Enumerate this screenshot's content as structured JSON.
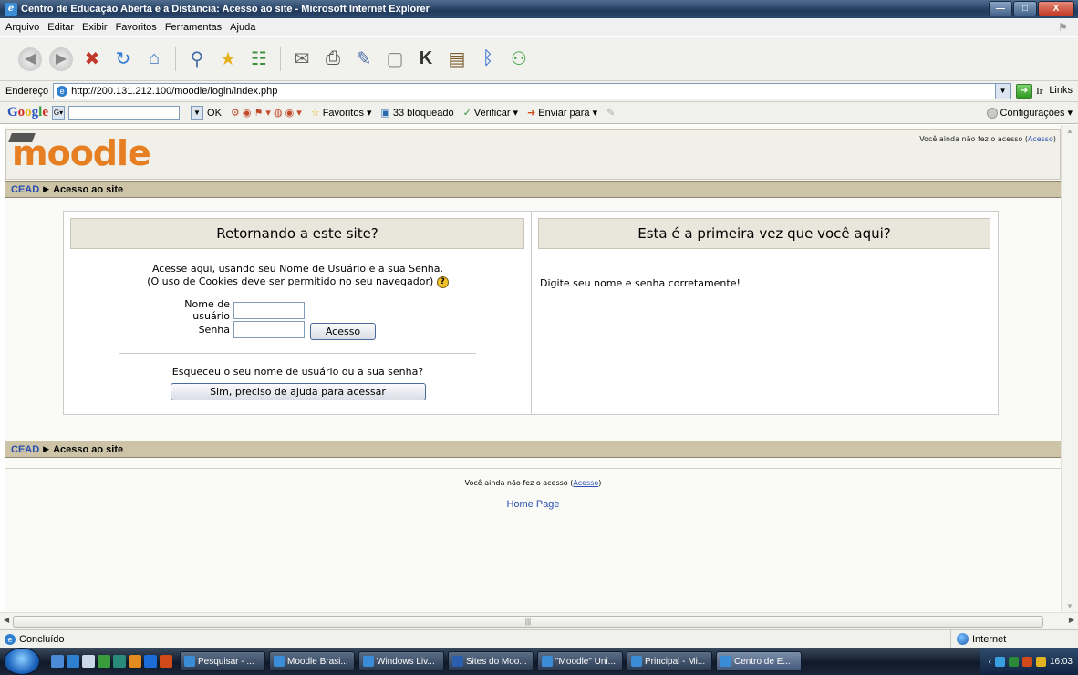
{
  "window": {
    "title": "Centro de Educação Aberta e a Distância: Acesso ao site - Microsoft Internet Explorer",
    "buttons": {
      "minimize": "—",
      "maximize": "□",
      "close": "X"
    }
  },
  "menubar": {
    "items": [
      "Arquivo",
      "Editar",
      "Exibir",
      "Favoritos",
      "Ferramentas",
      "Ajuda"
    ]
  },
  "addressbar": {
    "label": "Endereço",
    "url": "http://200.131.212.100/moodle/login/index.php",
    "go_label": "Ir",
    "links_label": "Links"
  },
  "googlebar": {
    "logo": "Google",
    "ok": "OK",
    "favoritos": "Favoritos",
    "blocked": "33 bloqueado",
    "verificar": "Verificar",
    "enviar": "Enviar para",
    "config": "Configurações"
  },
  "page": {
    "logo": "moodle",
    "login_info_text": "Você ainda não fez o acesso (",
    "login_info_link": "Acesso",
    "login_info_close": ")",
    "breadcrumb": {
      "home": "CEAD",
      "current": "Acesso ao site"
    },
    "left": {
      "heading": "Retornando a este site?",
      "intro_line1": "Acesse aqui, usando seu Nome de Usuário e a sua Senha.",
      "intro_line2": "(O uso de Cookies deve ser permitido no seu navegador)",
      "username_label": "Nome de usuário",
      "password_label": "Senha",
      "login_button": "Acesso",
      "forgot_text": "Esqueceu o seu nome de usuário ou a sua senha?",
      "help_button": "Sim, preciso de ajuda para acessar"
    },
    "right": {
      "heading": "Esta é a primeira vez que você aqui?",
      "message": "Digite seu nome e senha corretamente!"
    },
    "footer": {
      "login_info_text": "Você ainda não fez o acesso (",
      "login_info_link": "Acesso",
      "login_info_close": ")",
      "home_page": "Home Page"
    }
  },
  "statusbar": {
    "status": "Concluído",
    "zone": "Internet"
  },
  "taskbar": {
    "tasks": [
      "Pesquisar - ...",
      "Moodle Brasi...",
      "Windows Liv...",
      "Sites do Moo...",
      "\"Moodle\" Uni...",
      "Principal - Mi...",
      "Centro de E..."
    ],
    "clock": "16:03"
  }
}
